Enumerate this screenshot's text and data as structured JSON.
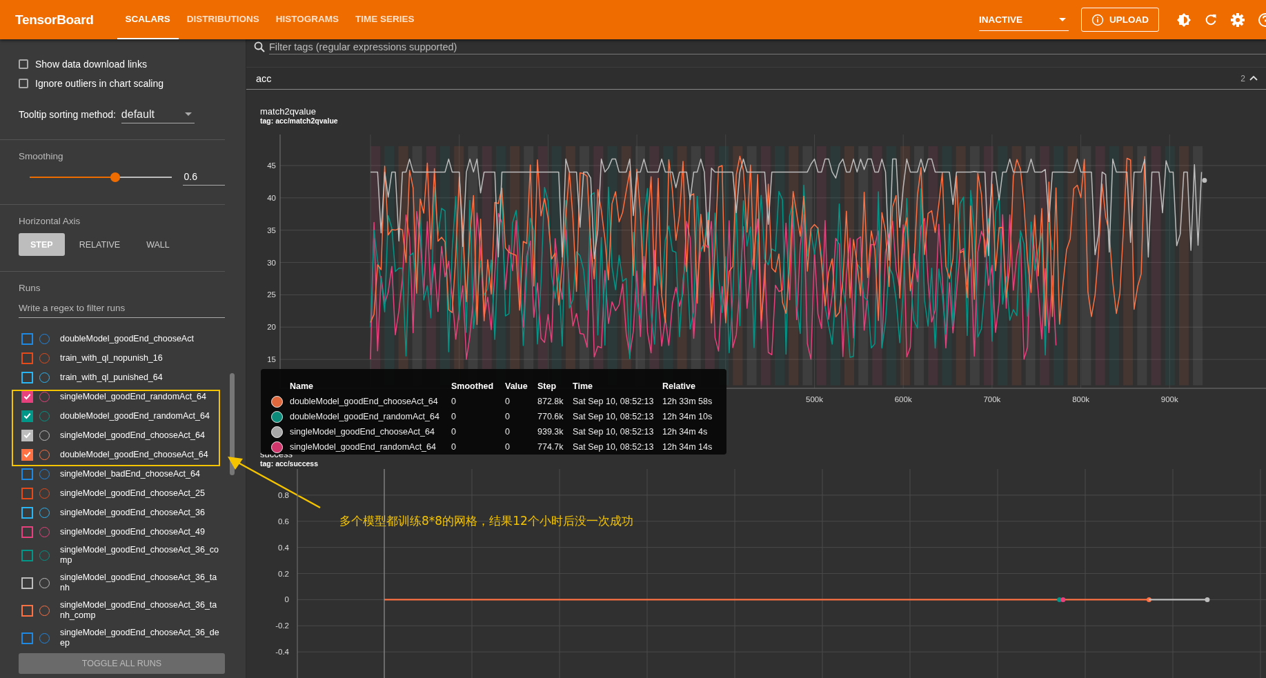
{
  "app": {
    "title": "TensorBoard",
    "tabs": [
      {
        "label": "SCALARS",
        "selected": true
      },
      {
        "label": "DISTRIBUTIONS",
        "selected": false
      },
      {
        "label": "HISTOGRAMS",
        "selected": false
      },
      {
        "label": "TIME SERIES",
        "selected": false
      }
    ],
    "status": "INACTIVE",
    "upload": "UPLOAD"
  },
  "sidebar": {
    "options": [
      {
        "label": "Show data download links",
        "checked": false
      },
      {
        "label": "Ignore outliers in chart scaling",
        "checked": false
      }
    ],
    "tooltip_sorting": {
      "label": "Tooltip sorting method:",
      "value": "default"
    },
    "smoothing": {
      "label": "Smoothing",
      "level": 0.6,
      "value": "0.6"
    },
    "horizontal_axis": {
      "label": "Horizontal Axis",
      "options": [
        {
          "label": "STEP",
          "selected": true
        },
        {
          "label": "RELATIVE",
          "selected": false
        },
        {
          "label": "WALL",
          "selected": false
        }
      ]
    },
    "runs": {
      "label": "Runs",
      "placeholder": "Write a regex to filter runs",
      "items": [
        {
          "name": "doubleModel_goodEnd_chooseAct",
          "checked": false,
          "color": "#1e88e5"
        },
        {
          "name": "train_with_ql_nopunish_16",
          "checked": false,
          "color": "#e64a19"
        },
        {
          "name": "train_with_ql_punished_64",
          "checked": false,
          "color": "#29b6f6"
        },
        {
          "name": "singleModel_goodEnd_randomAct_64",
          "checked": true,
          "color": "#e7407c"
        },
        {
          "name": "doubleModel_goodEnd_randomAct_64",
          "checked": true,
          "color": "#009688"
        },
        {
          "name": "singleModel_goodEnd_chooseAct_64",
          "checked": true,
          "color": "#bdbdbd"
        },
        {
          "name": "doubleModel_goodEnd_chooseAct_64",
          "checked": true,
          "color": "#ff7043"
        },
        {
          "name": "singleModel_badEnd_chooseAct_64",
          "checked": false,
          "color": "#1e88e5"
        },
        {
          "name": "singleModel_goodEnd_chooseAct_25",
          "checked": false,
          "color": "#e64a19"
        },
        {
          "name": "singleModel_goodEnd_chooseAct_36",
          "checked": false,
          "color": "#29b6f6"
        },
        {
          "name": "singleModel_goodEnd_chooseAct_49",
          "checked": false,
          "color": "#e7407c"
        },
        {
          "name": "singleModel_goodEnd_chooseAct_36_comp",
          "checked": false,
          "color": "#009688"
        },
        {
          "name": "singleModel_goodEnd_chooseAct_36_tanh",
          "checked": false,
          "color": "#bdbdbd"
        },
        {
          "name": "singleModel_goodEnd_chooseAct_36_tanh_comp",
          "checked": false,
          "color": "#ff7043"
        },
        {
          "name": "singleModel_goodEnd_chooseAct_36_deep",
          "checked": false,
          "color": "#1e88e5"
        }
      ],
      "toggle_all": "TOGGLE ALL RUNS"
    }
  },
  "main": {
    "filter_placeholder": "Filter tags (regular expressions supported)",
    "group": {
      "name": "acc",
      "count": "2",
      "expanded": true
    },
    "plot": {
      "title": "match2qvalue",
      "tag": "tag: acc/match2qvalue",
      "y_ticks": [
        "45",
        "40",
        "35",
        "30",
        "25",
        "20",
        "15"
      ],
      "x_ticks": [
        "500k",
        "600k",
        "700k",
        "800k",
        "900k"
      ],
      "lines": [
        {
          "color": "#e7407c"
        },
        {
          "color": "#009688"
        },
        {
          "color": "#ff7043"
        },
        {
          "color": "#bdbdbd"
        }
      ]
    },
    "chart": {
      "title": "success",
      "tag": "tag: acc/success",
      "y_ticks": [
        "0.8",
        "0.6",
        "0.4",
        "0.2",
        "0",
        "-0.2",
        "-0.4"
      ],
      "lines": [
        {
          "color": "#ff7043"
        },
        {
          "color": "#bdbdbd"
        },
        {
          "color": "#009688"
        },
        {
          "color": "#e7407c"
        }
      ]
    },
    "tooltip": {
      "columns": [
        "Name",
        "Smoothed",
        "Value",
        "Step",
        "Time",
        "Relative"
      ],
      "rows": [
        {
          "color": "#e0683d",
          "cells": [
            "doubleModel_goodEnd_chooseAct_64",
            "0",
            "0",
            "872.8k",
            "Sat Sep 10, 08:52:13",
            "12h 33m 58s"
          ]
        },
        {
          "color": "#0c8a7a",
          "cells": [
            "doubleModel_goodEnd_randomAct_64",
            "0",
            "0",
            "770.6k",
            "Sat Sep 10, 08:52:13",
            "12h 34m 10s"
          ]
        },
        {
          "color": "#a8a8a8",
          "cells": [
            "singleModel_goodEnd_chooseAct_64",
            "0",
            "0",
            "939.3k",
            "Sat Sep 10, 08:52:13",
            "12h 34m 4s"
          ]
        },
        {
          "color": "#d0356c",
          "cells": [
            "singleModel_goodEnd_randomAct_64",
            "0",
            "0",
            "774.7k",
            "Sat Sep 10, 08:52:13",
            "12h 34m 14s"
          ]
        }
      ]
    }
  },
  "annotation": {
    "note": "多个模型都训练8*8的网格，结果12个小时后没一次成功"
  }
}
